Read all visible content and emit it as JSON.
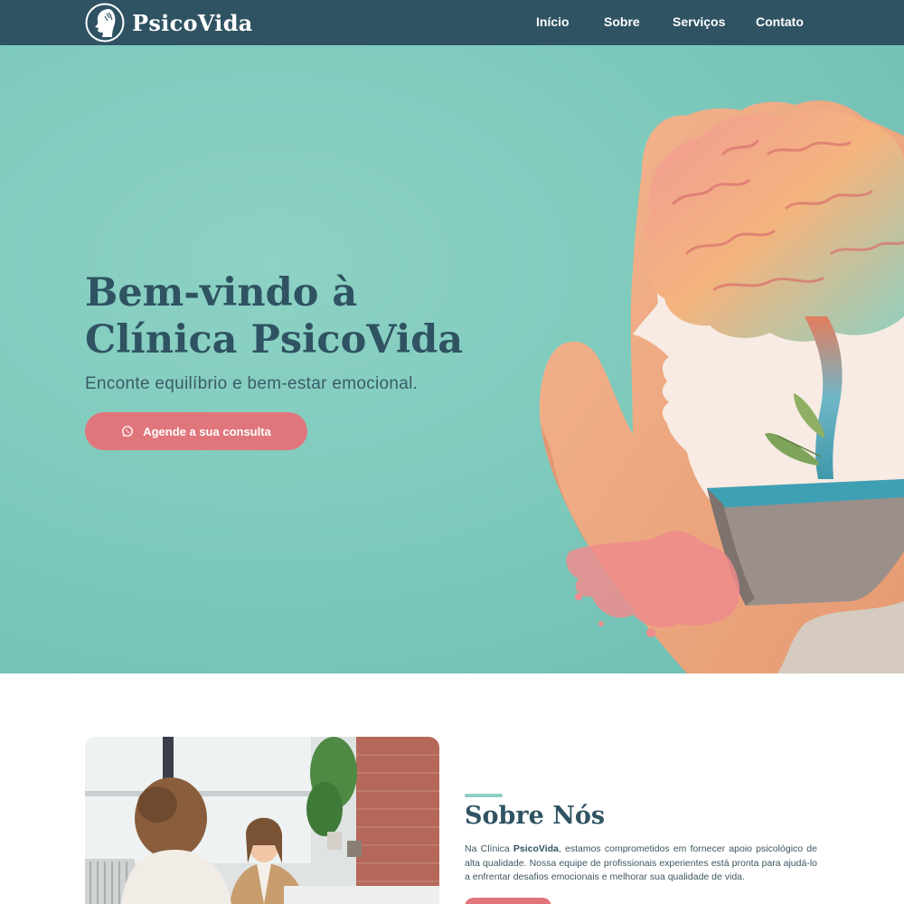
{
  "brand": {
    "name": "PsicoVida",
    "logo_icon": "woman-profile-tree-icon"
  },
  "nav": {
    "items": [
      {
        "label": "Início"
      },
      {
        "label": "Sobre"
      },
      {
        "label": "Serviços"
      },
      {
        "label": "Contato"
      }
    ]
  },
  "hero": {
    "title_line1": "Bem-vindo à",
    "title_line2": "Clínica PsicoVida",
    "subtitle": "Enconte equilíbrio e bem-estar emocional.",
    "cta_label": "Agende a sua consulta",
    "cta_icon": "whatsapp-icon",
    "image": "hand-holding-brain-plant-illustration"
  },
  "about": {
    "title": "Sobre Nós",
    "text_prefix": "Na Clínica ",
    "text_brand": "PsicoVida",
    "text_suffix": ", estamos comprometidos em fornecer apoio psicológico de alta qualidade. Nossa equipe de profissionais experientes está pronta para ajudá-lo a enfrentar desafios emocionais e melhorar sua qualidade de vida.",
    "image": "therapy-session-photo"
  },
  "colors": {
    "nav_bg": "#2f5363",
    "hero_bg": "#7fcabd",
    "accent": "#e0767c",
    "heading": "#2f5363",
    "underline": "#8fcfc3"
  }
}
